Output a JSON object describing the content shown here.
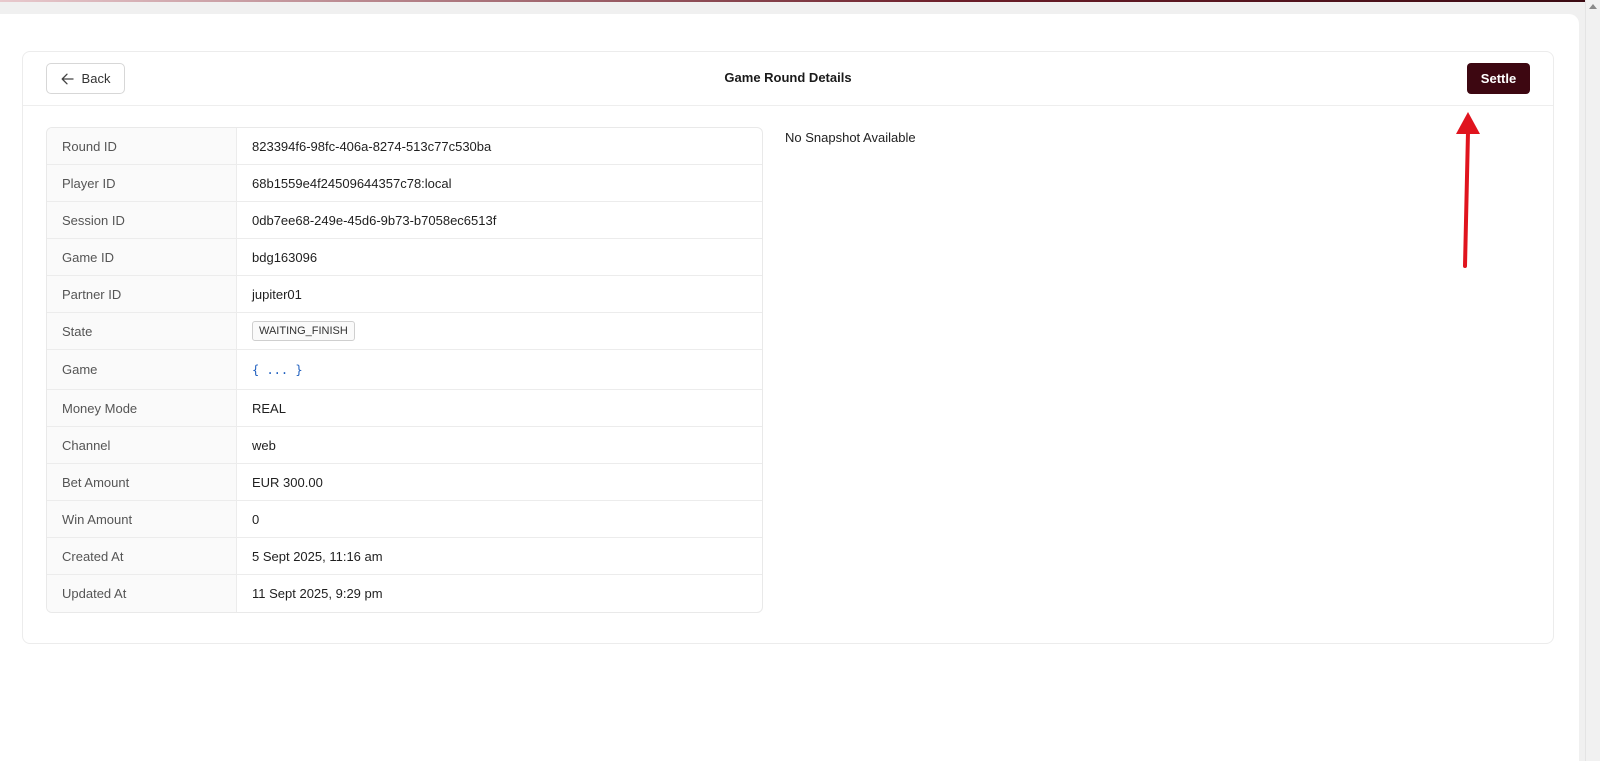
{
  "header": {
    "back_label": "Back",
    "title": "Game Round Details",
    "settle_label": "Settle"
  },
  "details": [
    {
      "label": "Round ID",
      "value": "823394f6-98fc-406a-8274-513c77c530ba"
    },
    {
      "label": "Player ID",
      "value": "68b1559e4f24509644357c78:local"
    },
    {
      "label": "Session ID",
      "value": "0db7ee68-249e-45d6-9b73-b7058ec6513f"
    },
    {
      "label": "Game ID",
      "value": "bdg163096"
    },
    {
      "label": "Partner ID",
      "value": "jupiter01"
    },
    {
      "label": "State",
      "value": "WAITING_FINISH"
    },
    {
      "label": "Game",
      "value": "{ ... }"
    },
    {
      "label": "Money Mode",
      "value": "REAL"
    },
    {
      "label": "Channel",
      "value": "web"
    },
    {
      "label": "Bet Amount",
      "value": "EUR 300.00"
    },
    {
      "label": "Win Amount",
      "value": "0"
    },
    {
      "label": "Created At",
      "value": "5 Sept 2025, 11:16 am"
    },
    {
      "label": "Updated At",
      "value": "11 Sept 2025, 9:29 pm"
    }
  ],
  "snapshot": {
    "message": "No Snapshot Available"
  },
  "colors": {
    "settle_button": "#3d0711",
    "annotation_arrow": "#e0141e",
    "json_link": "#1f5fbf"
  },
  "icons": {
    "back": "arrow-left-icon",
    "annotation": "red-arrow-up"
  }
}
